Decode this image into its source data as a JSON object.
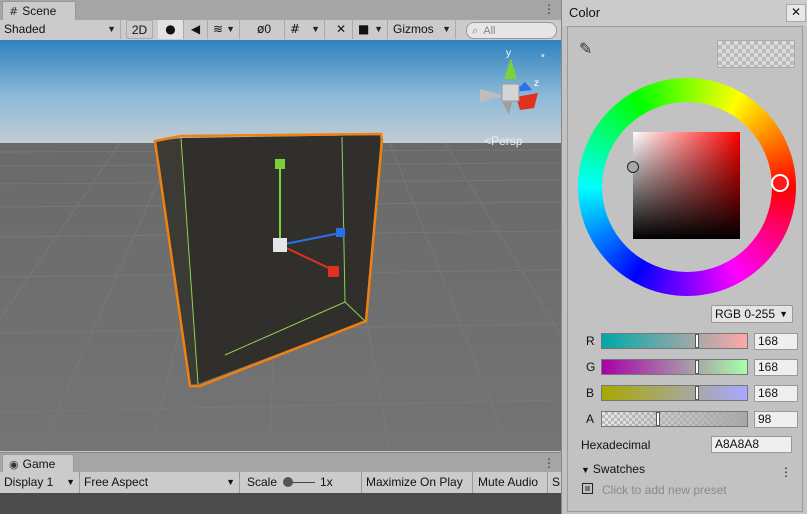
{
  "scene": {
    "tab_label": "Scene",
    "toolbar": {
      "shading_mode": "Shaded",
      "mode_2d": "2D",
      "hidden_count": "0",
      "gizmos_label": "Gizmos",
      "search_placeholder": "All"
    },
    "view": {
      "projection_label": "Persp",
      "gizmo_axes": {
        "y": "y",
        "z": "z"
      }
    }
  },
  "game": {
    "tab_label": "Game",
    "toolbar": {
      "display": "Display 1",
      "aspect": "Free Aspect",
      "scale_label": "Scale",
      "scale_value": "1x",
      "maximize_label": "Maximize On Play",
      "mute_label": "Mute Audio",
      "truncated_label": "S"
    }
  },
  "color_window": {
    "title": "Color",
    "mode": "RGB 0-255",
    "channels": [
      {
        "label": "R",
        "value": "168",
        "fraction": 0.659
      },
      {
        "label": "G",
        "value": "168",
        "fraction": 0.659
      },
      {
        "label": "B",
        "value": "168",
        "fraction": 0.659
      },
      {
        "label": "A",
        "value": "98",
        "fraction": 0.384
      }
    ],
    "hex_label": "Hexadecimal",
    "hex_value": "A8A8A8",
    "swatches_label": "Swatches",
    "swatches_hint": "Click to add new preset",
    "current_color": "#a8a8a8"
  },
  "colors": {
    "selection_outline": "#f08010",
    "axis_x": "#e0301e",
    "axis_y": "#7ad13a",
    "axis_z": "#2b70e6",
    "hue_handle": "#ff1a1a"
  }
}
